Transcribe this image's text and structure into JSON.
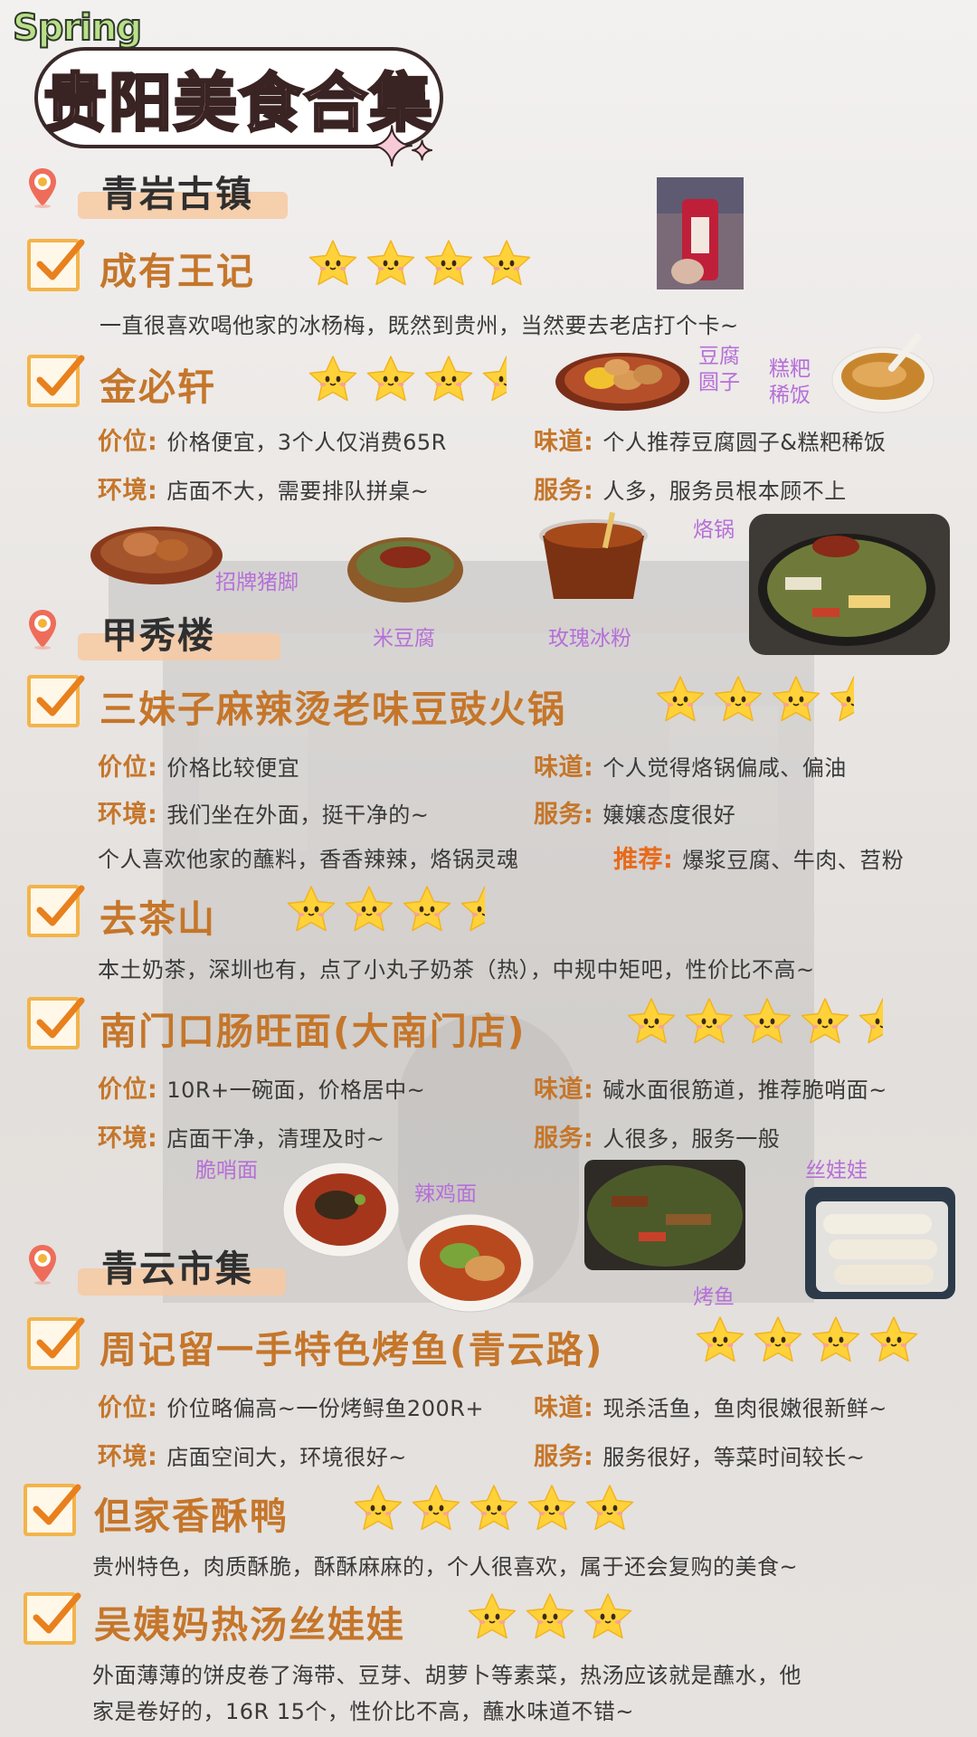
{
  "header": {
    "spring": "Spring",
    "title": "贵阳美食合集"
  },
  "sections": [
    {
      "name": "青岩古镇"
    },
    {
      "name": "甲秀楼"
    },
    {
      "name": "青云市集"
    }
  ],
  "restaurants": [
    {
      "name": "成有王记",
      "rating": 4,
      "note": "一直很喜欢喝他家的冰杨梅，既然到贵州，当然要去老店打个卡~"
    },
    {
      "name": "金必轩",
      "rating": 3.5,
      "price_label": "价位:",
      "price": "价格便宜，3个人仅消费65R",
      "taste_label": "味道:",
      "taste": "个人推荐豆腐圆子&糕粑稀饭",
      "env_label": "环境:",
      "env": "店面不大，需要排队拼桌~",
      "service_label": "服务:",
      "service": "人多，服务员根本顾不上"
    },
    {
      "name": "三妹子麻辣烫老味豆豉火锅",
      "rating": 3.5,
      "price_label": "价位:",
      "price": "价格比较便宜",
      "taste_label": "味道:",
      "taste": "个人觉得烙锅偏咸、偏油",
      "env_label": "环境:",
      "env": "我们坐在外面，挺干净的~",
      "service_label": "服务:",
      "service": "嬢嬢态度很好",
      "note": "个人喜欢他家的蘸料，香香辣辣，烙锅灵魂",
      "rec_label": "推荐:",
      "rec": "爆浆豆腐、牛肉、苕粉"
    },
    {
      "name": "去茶山",
      "rating": 3.5,
      "note": "本土奶茶，深圳也有，点了小丸子奶茶（热），中规中矩吧，性价比不高~"
    },
    {
      "name": "南门口肠旺面(大南门店)",
      "rating": 4.5,
      "price_label": "价位:",
      "price": "10R+一碗面，价格居中~",
      "taste_label": "味道:",
      "taste": "碱水面很筋道，推荐脆哨面~",
      "env_label": "环境:",
      "env": "店面干净，清理及时~",
      "service_label": "服务:",
      "service": "人很多，服务一般"
    },
    {
      "name": "周记留一手特色烤鱼(青云路)",
      "rating": 4,
      "price_label": "价位:",
      "price": "价位略偏高~一份烤鲟鱼200R+",
      "taste_label": "味道:",
      "taste": "现杀活鱼，鱼肉很嫩很新鲜~",
      "env_label": "环境:",
      "env": "店面空间大，环境很好~",
      "service_label": "服务:",
      "service": "服务很好，等菜时间较长~"
    },
    {
      "name": "但家香酥鸭",
      "rating": 5,
      "note": "贵州特色，肉质酥脆，酥酥麻麻的，个人很喜欢，属于还会复购的美食~"
    },
    {
      "name": "吴姨妈热汤丝娃娃",
      "rating": 3,
      "note1": "外面薄薄的饼皮卷了海带、豆芽、胡萝卜等素菜，热汤应该就是蘸水，他",
      "note2": "家是卷好的，16R 15个，性价比不高，蘸水味道不错~"
    }
  ],
  "photo_labels": {
    "tofu": "豆腐\n圆子",
    "gaoba": "糕粑\n稀饭",
    "pigfeet": "招牌猪脚",
    "midoufu": "米豆腐",
    "rose": "玫瑰冰粉",
    "laoguo": "烙锅",
    "cuishao": "脆哨面",
    "lajimian": "辣鸡面",
    "kaoyu": "烤鱼",
    "siwawa": "丝娃娃"
  },
  "colors": {
    "accent": "#c5762a",
    "label": "#c5762a",
    "photo_label": "#b66fd8",
    "star": "#ffd23a",
    "check": "#f3b44a"
  }
}
